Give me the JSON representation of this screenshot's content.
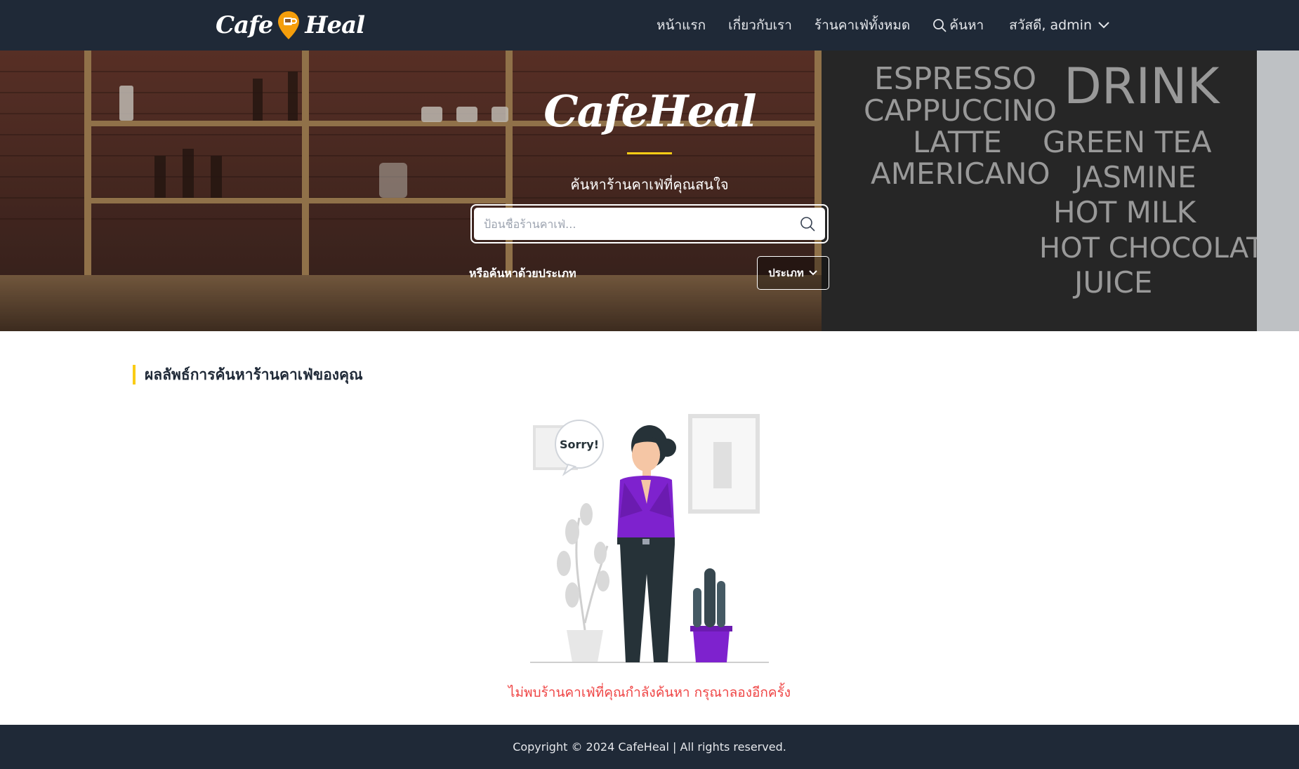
{
  "brand": {
    "left": "Cafe",
    "right": "Heal",
    "hero_title": "CafeHeal"
  },
  "nav": {
    "home": "หน้าแรก",
    "about": "เกี่ยวกับเรา",
    "all_cafes": "ร้านคาเฟ่ทั้งหมด",
    "search": "ค้นหา",
    "user_greeting": "สวัสดี, admin"
  },
  "hero": {
    "subtitle": "ค้นหาร้านคาเฟ่ที่คุณสนใจ",
    "search_placeholder": "ป้อนชื่อร้านคาเฟ่...",
    "category_prompt": "หรือค้นหาด้วยประเภท",
    "category_button": "ประเภท"
  },
  "results": {
    "heading": "ผลลัพธ์การค้นหาร้านคาเฟ่ของคุณ",
    "illustration_text": "Sorry!",
    "empty_message": "ไม่พบร้านคาเฟ่ที่คุณกำลังค้นหา กรุณาลองอีกครั้ง"
  },
  "footer": {
    "copyright": "Copyright © 2024 CafeHeal | All rights reserved."
  },
  "colors": {
    "navbar": "#1f2937",
    "accent_yellow": "#facc15",
    "pin_orange": "#f59e0b",
    "error_red": "#ef4444",
    "illustration_purple": "#7e22ce"
  },
  "icons": {
    "pin": "location-pin-coffee-icon",
    "search": "search-icon",
    "chevron": "chevron-down-icon"
  }
}
